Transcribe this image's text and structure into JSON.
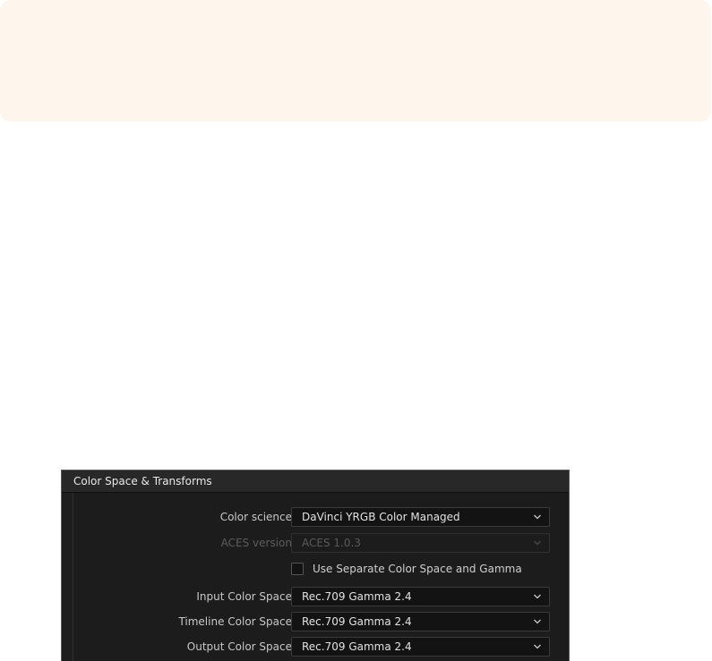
{
  "panel": {
    "title": "Color Space & Transforms",
    "rows": [
      {
        "label": "Color science",
        "value": "DaVinci YRGB Color Managed",
        "enabled": true
      },
      {
        "label": "ACES version",
        "value": "ACES 1.0.3",
        "enabled": false
      },
      {
        "label": "Input Color Space",
        "value": "Rec.709 Gamma 2.4",
        "enabled": true
      },
      {
        "label": "Timeline Color Space",
        "value": "Rec.709 Gamma 2.4",
        "enabled": true
      },
      {
        "label": "Output Color Space",
        "value": "Rec.709 Gamma 2.4",
        "enabled": true
      }
    ],
    "separate_gamma_checkbox": {
      "label": "Use Separate Color Space and Gamma",
      "checked": false
    }
  },
  "colors": {
    "note_background": "#fef6ec",
    "panel_background": "#1e1e1e",
    "dropdown_background": "#131313"
  },
  "icons": {
    "dropdown": "chevron-down-icon"
  }
}
